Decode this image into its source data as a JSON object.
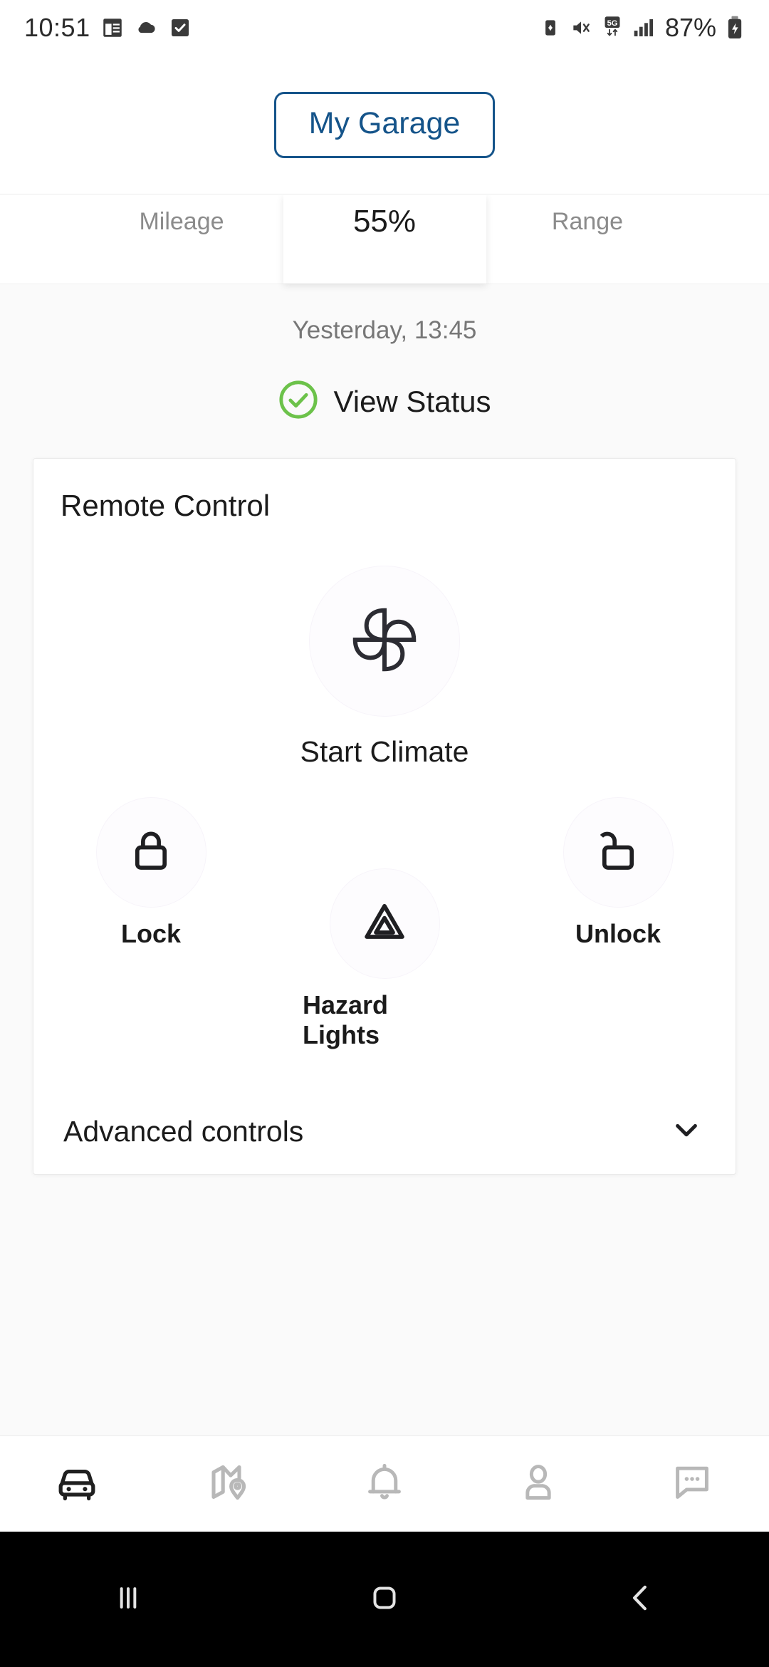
{
  "status_bar": {
    "time": "10:51",
    "battery_percent": "87%",
    "left_icons": [
      "calendar-icon",
      "weather-cloud-icon",
      "checkbox-checked-icon"
    ],
    "right_icons": [
      "battery-saver-icon",
      "mute-vibrate-icon",
      "5g-network-icon",
      "signal-bars-icon",
      "battery-charging-icon"
    ]
  },
  "header": {
    "garage_button_label": "My Garage",
    "accent_color": "#15548a"
  },
  "stats": {
    "items": [
      {
        "label": "Mileage"
      },
      {
        "label": "55%"
      },
      {
        "label": "Range"
      }
    ],
    "selected_index": 1
  },
  "vehicle": {
    "last_updated": "Yesterday, 13:45",
    "status_link_label": "View Status",
    "status_icon": "check-circle-icon",
    "status_color": "#6cc24a"
  },
  "remote_control": {
    "title": "Remote Control",
    "primary": {
      "label": "Start Climate",
      "icon": "fan-pinwheel-icon"
    },
    "actions": [
      {
        "label": "Lock",
        "icon": "lock-closed-icon"
      },
      {
        "label": "Hazard Lights",
        "icon": "hazard-triangle-icon"
      },
      {
        "label": "Unlock",
        "icon": "lock-open-icon"
      }
    ],
    "advanced": {
      "label": "Advanced controls",
      "icon": "chevron-down-icon",
      "expanded": false
    }
  },
  "bottom_nav": {
    "items": [
      {
        "name": "vehicle",
        "icon": "car-icon",
        "active": true
      },
      {
        "name": "map",
        "icon": "map-pin-icon",
        "active": false
      },
      {
        "name": "notifications",
        "icon": "bell-icon",
        "active": false
      },
      {
        "name": "profile",
        "icon": "person-icon",
        "active": false
      },
      {
        "name": "messages",
        "icon": "chat-bubble-icon",
        "active": false
      }
    ],
    "active_color": "#202020",
    "inactive_color": "#b8b8b8"
  },
  "android_nav": {
    "buttons": [
      {
        "name": "recents",
        "icon": "recents-icon"
      },
      {
        "name": "home",
        "icon": "home-square-icon"
      },
      {
        "name": "back",
        "icon": "back-chevron-icon"
      }
    ]
  }
}
